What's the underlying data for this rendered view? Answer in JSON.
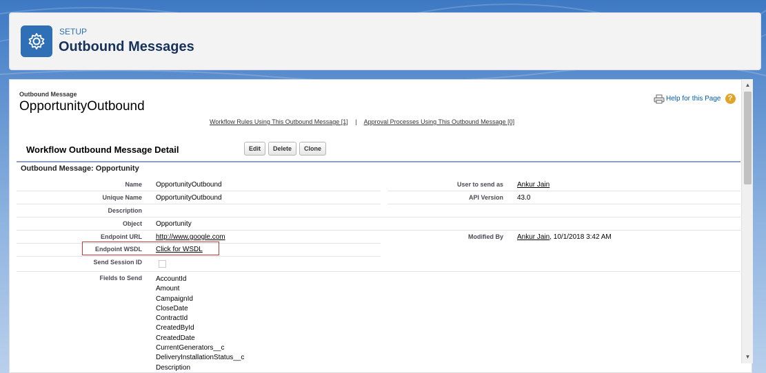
{
  "header": {
    "setup_label": "SETUP",
    "title": "Outbound Messages"
  },
  "page": {
    "type_label": "Outbound Message",
    "name": "OpportunityOutbound",
    "help_link": "Help for this Page",
    "help_icon": "?",
    "related": {
      "workflow_rules": "Workflow Rules Using This Outbound Message [1]",
      "separator": "|",
      "approval_processes": "Approval Processes Using This Outbound Message [0]"
    }
  },
  "detail": {
    "title": "Workflow Outbound Message Detail",
    "buttons": {
      "edit": "Edit",
      "delete": "Delete",
      "clone": "Clone"
    },
    "section_title": "Outbound Message: Opportunity",
    "left_fields": [
      {
        "label": "Name",
        "value": "OpportunityOutbound"
      },
      {
        "label": "Unique Name",
        "value": "OpportunityOutbound"
      },
      {
        "label": "Description",
        "value": ""
      },
      {
        "label": "Object",
        "value": "Opportunity"
      },
      {
        "label": "Endpoint URL",
        "value": "http://www.google.com"
      },
      {
        "label": "Endpoint WSDL",
        "value": "Click for WSDL"
      },
      {
        "label": "Send Session ID",
        "value": ""
      },
      {
        "label": "Fields to Send",
        "value": ""
      }
    ],
    "right_fields": {
      "user_to_send_as": {
        "label": "User to send as",
        "value": "Ankur Jain"
      },
      "api_version": {
        "label": "API Version",
        "value": "43.0"
      },
      "modified_by": {
        "label": "Modified By",
        "user": "Ankur Jain",
        "date": ", 10/1/2018 3:42 AM"
      }
    },
    "fields_to_send": [
      "AccountId",
      "Amount",
      "CampaignId",
      "CloseDate",
      "ContractId",
      "CreatedById",
      "CreatedDate",
      "CurrentGenerators__c",
      "DeliveryInstallationStatus__c",
      "Description"
    ]
  },
  "colors": {
    "brand": "#2f6fb5",
    "highlight_border": "#c23934",
    "help_icon": "#e2a329"
  }
}
